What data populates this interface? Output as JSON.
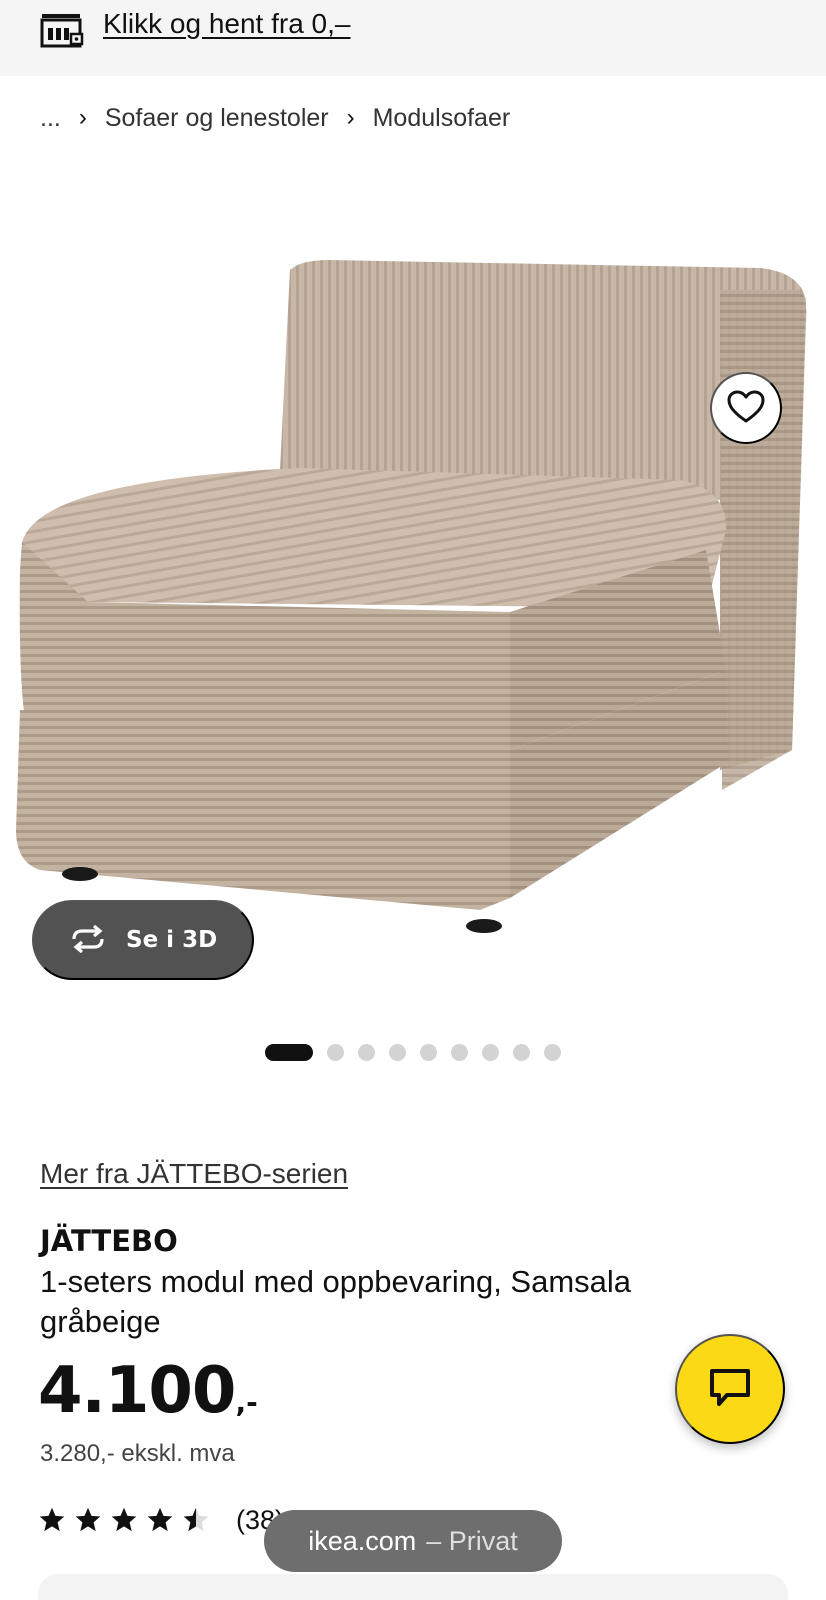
{
  "topbar": {
    "icon": "store-icon",
    "link_label": "Klikk og hent fra 0,–"
  },
  "breadcrumb": {
    "ellipsis": "...",
    "items": [
      "Sofaer og lenestoler",
      "Modulsofaer"
    ],
    "separator": "›"
  },
  "gallery": {
    "favorite_icon": "heart-icon",
    "view3d_icon": "rotate-icon",
    "view3d_label": "Se i 3D",
    "slide_count": 9,
    "active_slide": 1
  },
  "product": {
    "series_link": "Mer fra JÄTTEBO-serien",
    "name": "JÄTTEBO",
    "description": "1-seters modul med oppbevaring, Samsala gråbeige",
    "price_main": "4.100",
    "price_suffix": ",-",
    "price_ex_vat": "3.280,- ekskl. mva",
    "rating": 4.5,
    "rating_max": 5,
    "review_count": "(38)"
  },
  "chat": {
    "icon": "chat-bubble-icon",
    "color": "#fbd914"
  },
  "browser": {
    "domain": "ikea.com",
    "mode": "– Privat"
  }
}
